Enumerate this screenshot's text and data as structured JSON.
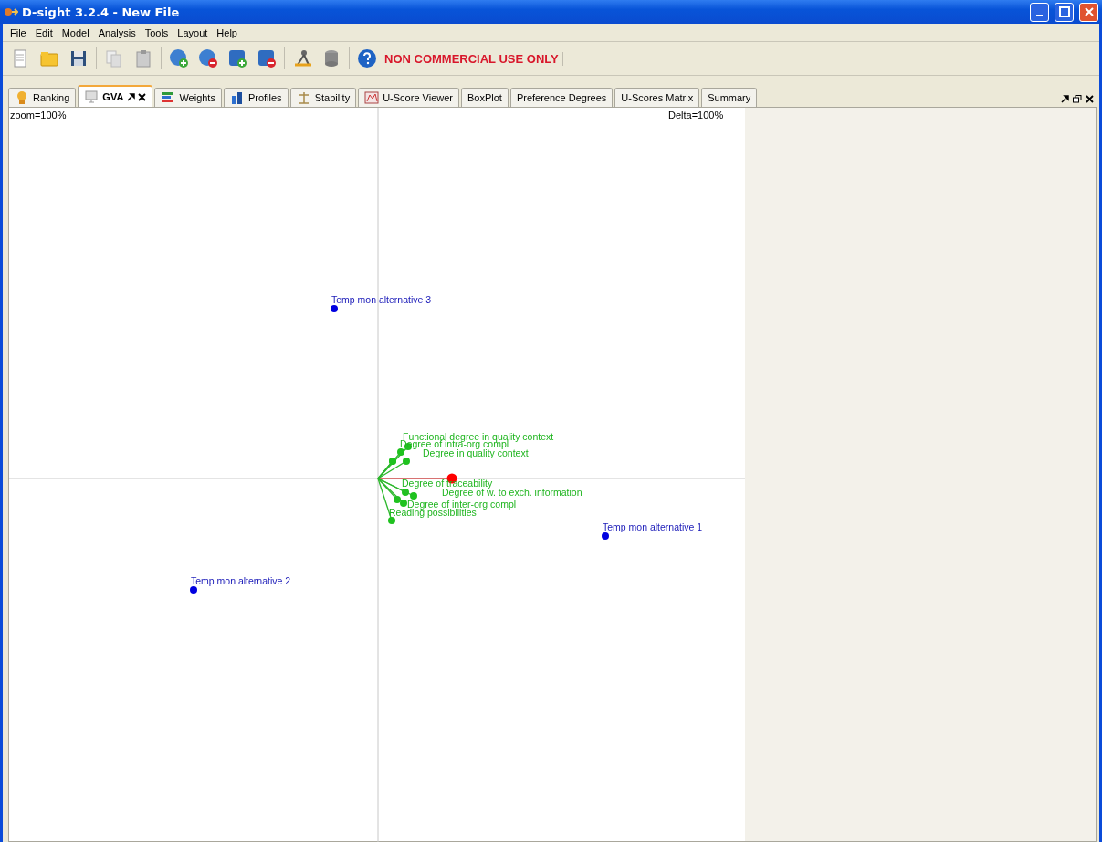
{
  "window": {
    "title": "D-sight 3.2.4 - New File"
  },
  "menu": [
    {
      "label": "File"
    },
    {
      "label": "Edit"
    },
    {
      "label": "Model"
    },
    {
      "label": "Analysis"
    },
    {
      "label": "Tools"
    },
    {
      "label": "Layout"
    },
    {
      "label": "Help"
    }
  ],
  "toolbar": {
    "notice": "NON COMMERCIAL USE ONLY"
  },
  "tabs": [
    {
      "label": "Ranking",
      "selected": false,
      "closable": false
    },
    {
      "label": "GVA",
      "selected": true,
      "closable": true
    },
    {
      "label": "Weights",
      "selected": false,
      "closable": false
    },
    {
      "label": "Profiles",
      "selected": false,
      "closable": false
    },
    {
      "label": "Stability",
      "selected": false,
      "closable": false
    },
    {
      "label": "U-Score Viewer",
      "selected": false,
      "closable": false
    },
    {
      "label": "BoxPlot",
      "selected": false,
      "closable": false
    },
    {
      "label": "Preference Degrees",
      "selected": false,
      "closable": false
    },
    {
      "label": "U-Scores Matrix",
      "selected": false,
      "closable": false
    },
    {
      "label": "Summary",
      "selected": false,
      "closable": false
    }
  ],
  "canvas": {
    "zoom": "zoom=100%",
    "delta": "Delta=100%",
    "alternatives": [
      {
        "label": "Temp mon alternative 3"
      },
      {
        "label": "Temp mon alternative 2"
      },
      {
        "label": "Temp mon alternative 1"
      }
    ],
    "criteria": [
      {
        "label": "Functional degree in quality context"
      },
      {
        "label": "Degree of intra-org compl"
      },
      {
        "label": "Degree in quality context"
      },
      {
        "label": "Degree of traceability"
      },
      {
        "label": "Degree of w. to exch. information"
      },
      {
        "label": "Degree of inter-org compl"
      },
      {
        "label": "Reading possibilities"
      }
    ]
  }
}
